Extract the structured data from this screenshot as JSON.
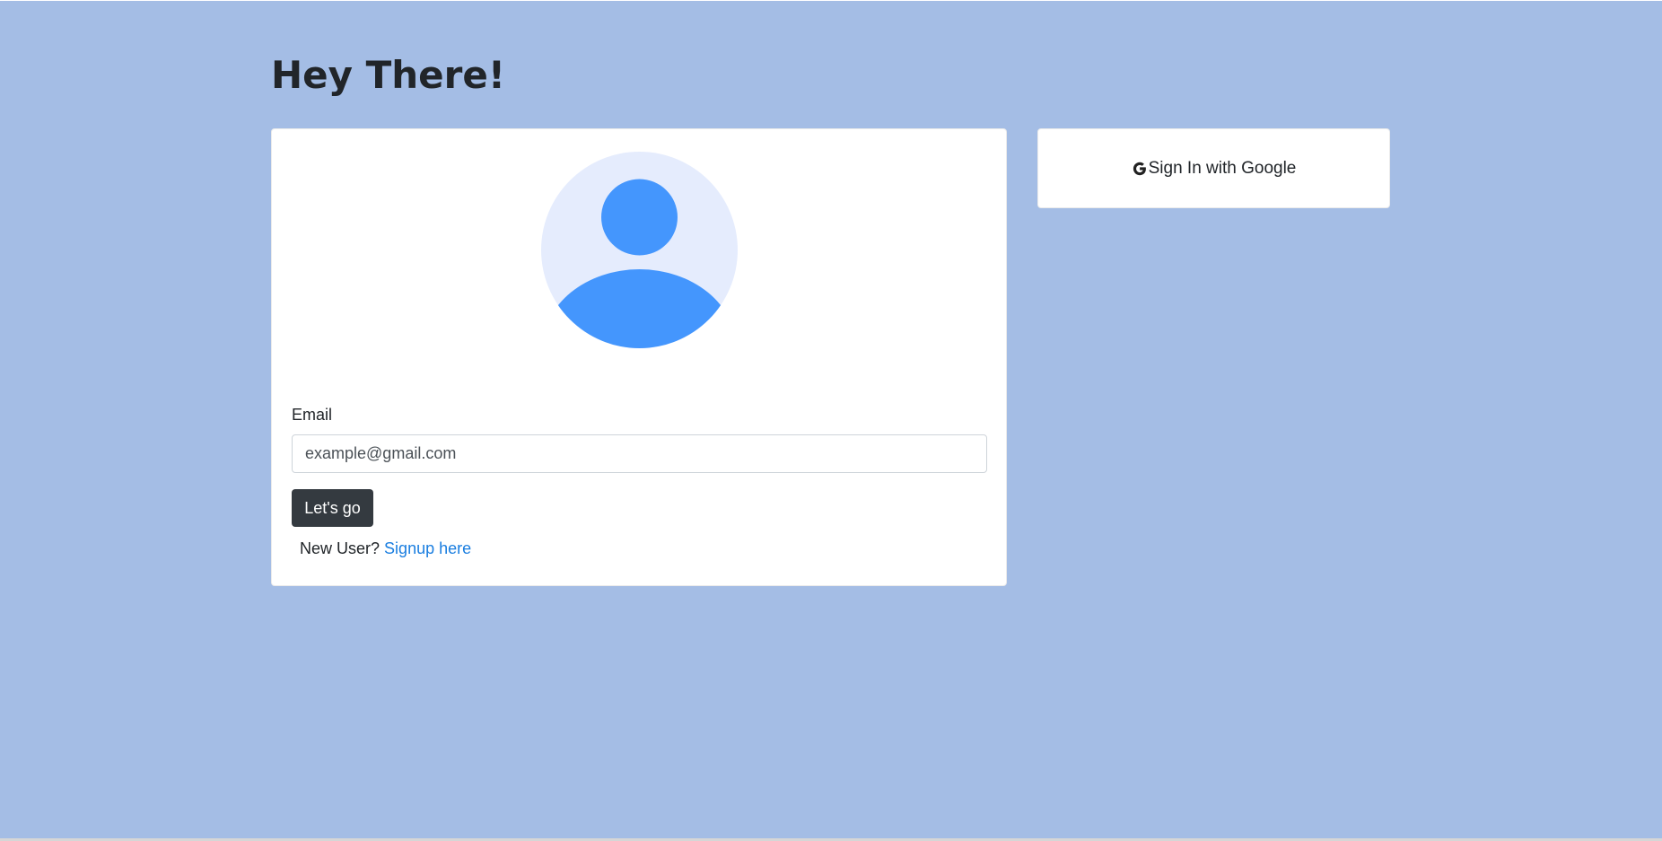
{
  "header": {
    "title": "Hey There!"
  },
  "login_form": {
    "email_label": "Email",
    "email_placeholder": "example@gmail.com",
    "email_value": "",
    "submit_label": "Let's go",
    "signup_prompt": "New User?",
    "signup_link": "Signup here"
  },
  "google_signin": {
    "icon": "google-g-icon",
    "label": "Sign In with Google"
  },
  "avatar": {
    "icon": "user-avatar-icon"
  },
  "colors": {
    "page_background": "#a4bde5",
    "avatar_background": "#e5ecfd",
    "avatar_foreground": "#4496fd",
    "button_dark": "#343a40",
    "link": "#1a7ee0"
  }
}
